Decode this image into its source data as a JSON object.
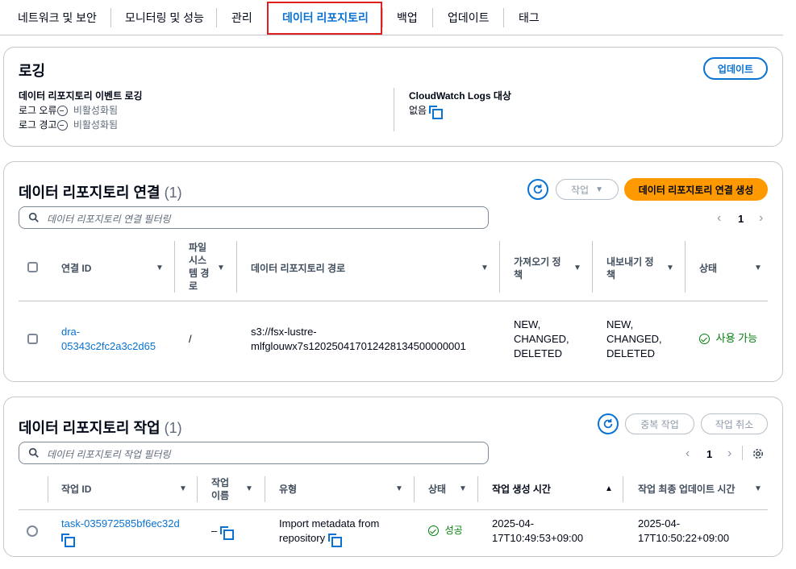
{
  "tabs": [
    {
      "label": "네트워크 및 보안"
    },
    {
      "label": "모니터링 및 성능"
    },
    {
      "label": "관리"
    },
    {
      "label": "데이터 리포지토리"
    },
    {
      "label": "백업"
    },
    {
      "label": "업데이트"
    },
    {
      "label": "태그"
    }
  ],
  "logging": {
    "title": "로깅",
    "update_button": "업데이트",
    "event_logging_label": "데이터 리포지토리 이벤트 로깅",
    "log_errors_label": "로그 오류",
    "log_errors_value": "비활성화됨",
    "log_warnings_label": "로그 경고",
    "log_warnings_value": "비활성화됨",
    "cloudwatch_label": "CloudWatch Logs 대상",
    "cloudwatch_value": "없음"
  },
  "associations": {
    "title": "데이터 리포지토리 연결",
    "count": "(1)",
    "actions_button": "작업",
    "create_button": "데이터 리포지토리 연결 생성",
    "filter_placeholder": "데이터 리포지토리 연결 필터링",
    "page": "1",
    "columns": [
      "연결 ID",
      "파일 시스템 경로",
      "데이터 리포지토리 경로",
      "가져오기 정책",
      "내보내기 정책",
      "상태"
    ],
    "column_lines": {
      "fs_path": [
        "파일",
        "시스",
        "템 경",
        "로"
      ],
      "import": [
        "가져오기 정",
        "책"
      ],
      "export": [
        "내보내기 정",
        "책"
      ]
    },
    "rows": [
      {
        "id_line1": "dra-",
        "id_line2": "05343c2fc2a3c2d65",
        "fs_path": "/",
        "repo_line1": "s3://fsx-lustre-",
        "repo_line2": "mlfglouwx7s120250417012428134500000001",
        "import_lines": [
          "NEW,",
          "CHANGED,",
          "DELETED"
        ],
        "export_lines": [
          "NEW,",
          "CHANGED,",
          "DELETED"
        ],
        "status": "사용 가능"
      }
    ]
  },
  "tasks": {
    "title": "데이터 리포지토리 작업",
    "count": "(1)",
    "duplicate_button": "중복 작업",
    "cancel_button": "작업 취소",
    "filter_placeholder": "데이터 리포지토리 작업 필터링",
    "page": "1",
    "columns": [
      "작업 ID",
      "작업 이름",
      "유형",
      "상태",
      "작업 생성 시간",
      "작업 최종 업데이트 시간"
    ],
    "column_lines": {
      "name": [
        "작업",
        "이름"
      ]
    },
    "rows": [
      {
        "id": "task-035972585bf6ec32d",
        "name": "–",
        "type_line1": "Import metadata from",
        "type_line2": "repository",
        "status": "성공",
        "created_line1": "2025-04-",
        "created_line2": "17T10:49:53+09:00",
        "updated_line1": "2025-04-",
        "updated_line2": "17T10:50:22+09:00"
      }
    ]
  },
  "colors": {
    "accent": "#0972d3",
    "primary_button": "#ff9900",
    "success": "#037f0c",
    "highlight_border": "#e0201f"
  },
  "icons": [
    "refresh-icon",
    "search-icon",
    "chevron-left-icon",
    "chevron-right-icon",
    "settings-icon",
    "copy-icon",
    "status-disabled-icon",
    "status-success-icon",
    "caret-down-icon",
    "sort-ascending-icon"
  ]
}
